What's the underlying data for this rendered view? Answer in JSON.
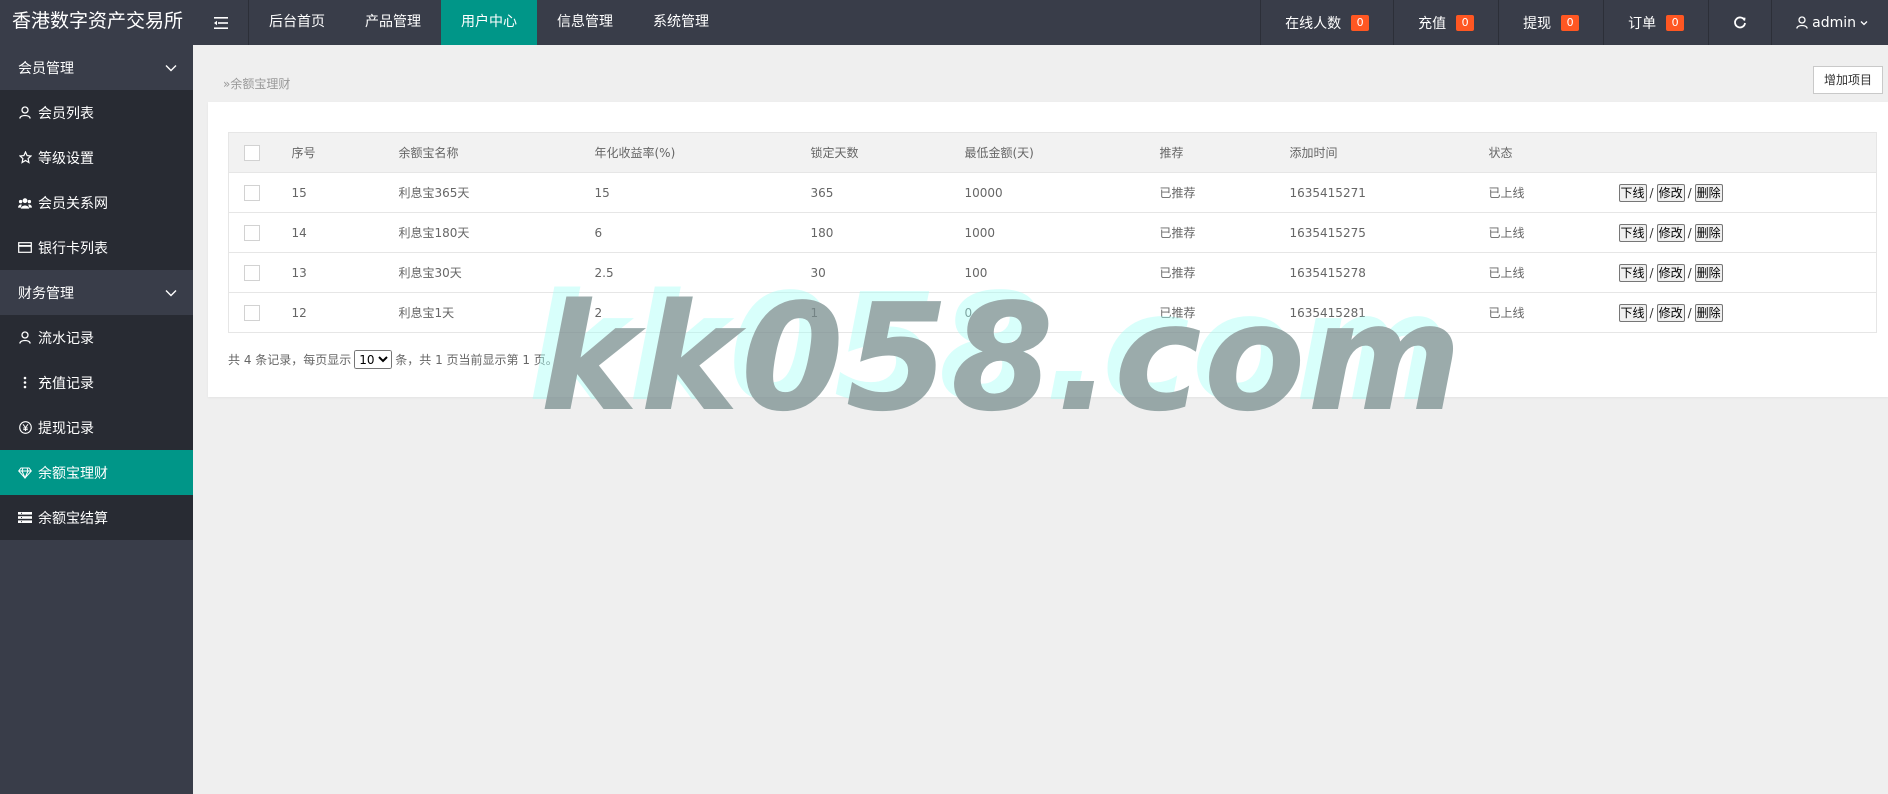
{
  "header": {
    "logo": "香港数字资产交易所",
    "nav": [
      {
        "label": "后台首页"
      },
      {
        "label": "产品管理"
      },
      {
        "label": "用户中心",
        "active": true
      },
      {
        "label": "信息管理"
      },
      {
        "label": "系统管理"
      }
    ],
    "stats": [
      {
        "label": "在线人数",
        "count": "0"
      },
      {
        "label": "充值",
        "count": "0"
      },
      {
        "label": "提现",
        "count": "0"
      },
      {
        "label": "订单",
        "count": "0"
      }
    ],
    "user": "admin"
  },
  "sidebar": {
    "groups": [
      {
        "label": "会员管理",
        "items": [
          {
            "label": "会员列表",
            "icon": "user-icon"
          },
          {
            "label": "等级设置",
            "icon": "star-icon"
          },
          {
            "label": "会员关系网",
            "icon": "users-icon"
          },
          {
            "label": "银行卡列表",
            "icon": "credit-card-icon"
          }
        ]
      },
      {
        "label": "财务管理",
        "items": [
          {
            "label": "流水记录",
            "icon": "user-icon"
          },
          {
            "label": "充值记录",
            "icon": "more-vertical-icon"
          },
          {
            "label": "提现记录",
            "icon": "yen-icon"
          },
          {
            "label": "余额宝理财",
            "icon": "diamond-icon",
            "active": true
          },
          {
            "label": "余额宝结算",
            "icon": "list-icon"
          }
        ]
      }
    ]
  },
  "main": {
    "breadcrumb": "余额宝理财",
    "add_button": "增加项目",
    "table": {
      "columns": [
        "序号",
        "余额宝名称",
        "年化收益率(%)",
        "锁定天数",
        "最低金额(天)",
        "推荐",
        "添加时间",
        "状态"
      ],
      "rows": [
        {
          "id": "15",
          "name": "利息宝365天",
          "rate": "15",
          "days": "365",
          "min": "10000",
          "recommend": "已推荐",
          "time": "1635415271",
          "status": "已上线"
        },
        {
          "id": "14",
          "name": "利息宝180天",
          "rate": "6",
          "days": "180",
          "min": "1000",
          "recommend": "已推荐",
          "time": "1635415275",
          "status": "已上线"
        },
        {
          "id": "13",
          "name": "利息宝30天",
          "rate": "2.5",
          "days": "30",
          "min": "100",
          "recommend": "已推荐",
          "time": "1635415278",
          "status": "已上线"
        },
        {
          "id": "12",
          "name": "利息宝1天",
          "rate": "2",
          "days": "1",
          "min": "0",
          "recommend": "已推荐",
          "time": "1635415281",
          "status": "已上线"
        }
      ],
      "actions": {
        "offline": "下线",
        "edit": "修改",
        "delete": "删除",
        "sep": "/"
      }
    },
    "pager": {
      "prefix": "共 4 条记录，每页显示",
      "page_size": "10",
      "suffix": "条，共 1 页当前显示第 1 页。"
    }
  },
  "watermark": "kk058.com"
}
